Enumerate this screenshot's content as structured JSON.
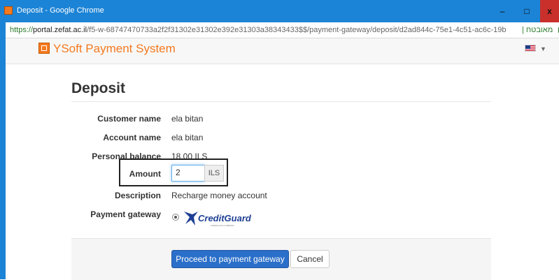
{
  "window": {
    "title": "Deposit - Google Chrome",
    "minimize_glyph": "–",
    "maximize_glyph": "□",
    "close_glyph": "x"
  },
  "address": {
    "proto": "https://",
    "host": "portal.zefat.ac.il",
    "path": "/f5-w-68747470733a2f2f31302e31302e392e31303a38343433$$/payment-gateway/deposit/d2ad844c-75e1-4c51-ac6c-19b",
    "secure_label": "| מאובטח"
  },
  "app": {
    "brand": "YSoft Payment System",
    "language_icon": "us-flag-icon"
  },
  "page": {
    "title": "Deposit"
  },
  "form": {
    "customer_name_label": "Customer name",
    "customer_name": "ela bitan",
    "account_name_label": "Account name",
    "account_name": "ela bitan",
    "balance_label": "Personal balance",
    "balance": "18.00 ILS",
    "amount_label": "Amount",
    "amount_value": "2",
    "amount_currency": "ILS",
    "description_label": "Description",
    "description": "Recharge money account",
    "gateway_label": "Payment gateway",
    "gateway_name": "CreditGuard",
    "gateway_tagline": "A BARCLAYS COMPANY"
  },
  "actions": {
    "proceed_label": "Proceed to payment gateway",
    "cancel_label": "Cancel"
  },
  "colors": {
    "titlebar": "#1c84d6",
    "brand": "#f47a20",
    "primary_button": "#2a6fc9",
    "close_button": "#c9302c"
  }
}
